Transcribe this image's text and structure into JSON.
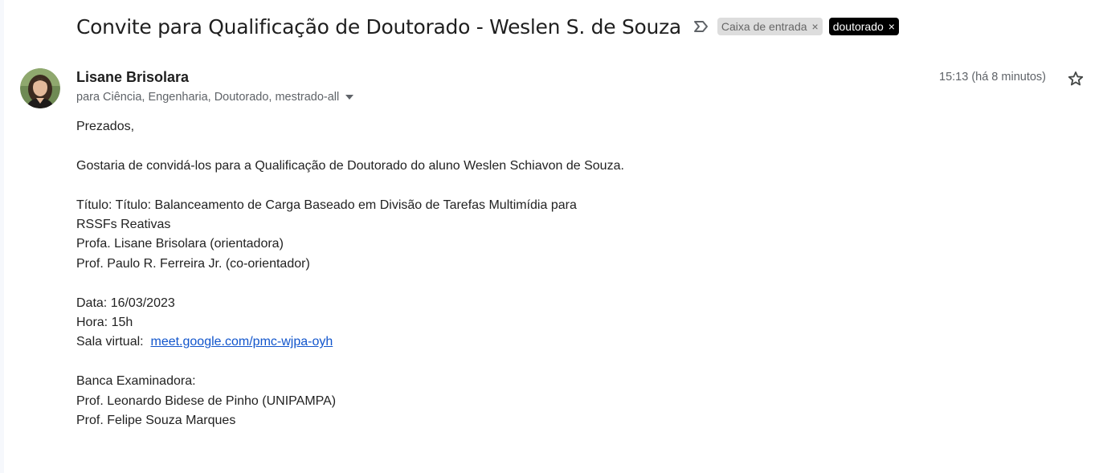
{
  "email": {
    "subject": "Convite para Qualificação de Doutorado - Weslen S. de Souza",
    "labels": [
      {
        "text": "Caixa de entrada",
        "remove": "×"
      },
      {
        "text": "doutorado",
        "remove": "×"
      }
    ],
    "sender_name": "Lisane Brisolara",
    "recipients": "para Ciência, Engenharia, Doutorado, mestrado-all",
    "timestamp": "15:13 (há 8 minutos)",
    "body": {
      "greeting": "Prezados,",
      "intro": "Gostaria de convidá-los para a Qualificação de Doutorado do aluno Weslen Schiavon de Souza.",
      "title_line1": "Título: Título: Balanceamento de Carga Baseado em Divisão de Tarefas Multimídia para",
      "title_line2": "RSSFs Reativas",
      "advisor": "Profa. Lisane Brisolara (orientadora)",
      "coadvisor": "Prof. Paulo R. Ferreira Jr. (co-orientador)",
      "date": "Data: 16/03/2023",
      "time": "Hora: 15h",
      "room_label": "Sala virtual:",
      "room_link": "meet.google.com/pmc-wjpa-oyh",
      "committee_heading": "Banca Examinadora:",
      "committee_member_1": "Prof. Leonardo Bidese de Pinho (UNIPAMPA)",
      "committee_member_2": "Prof. Felipe Souza Marques"
    }
  },
  "icons": {
    "importance": "importance-marker-icon",
    "caret": "caret-down-icon",
    "star": "star-outline-icon",
    "avatar": "sender-avatar"
  },
  "colors": {
    "link": "#1155cc",
    "label_inbox_bg": "#dddddd",
    "label_doutorado_bg": "#000000",
    "secondary_text": "#5f6368"
  }
}
